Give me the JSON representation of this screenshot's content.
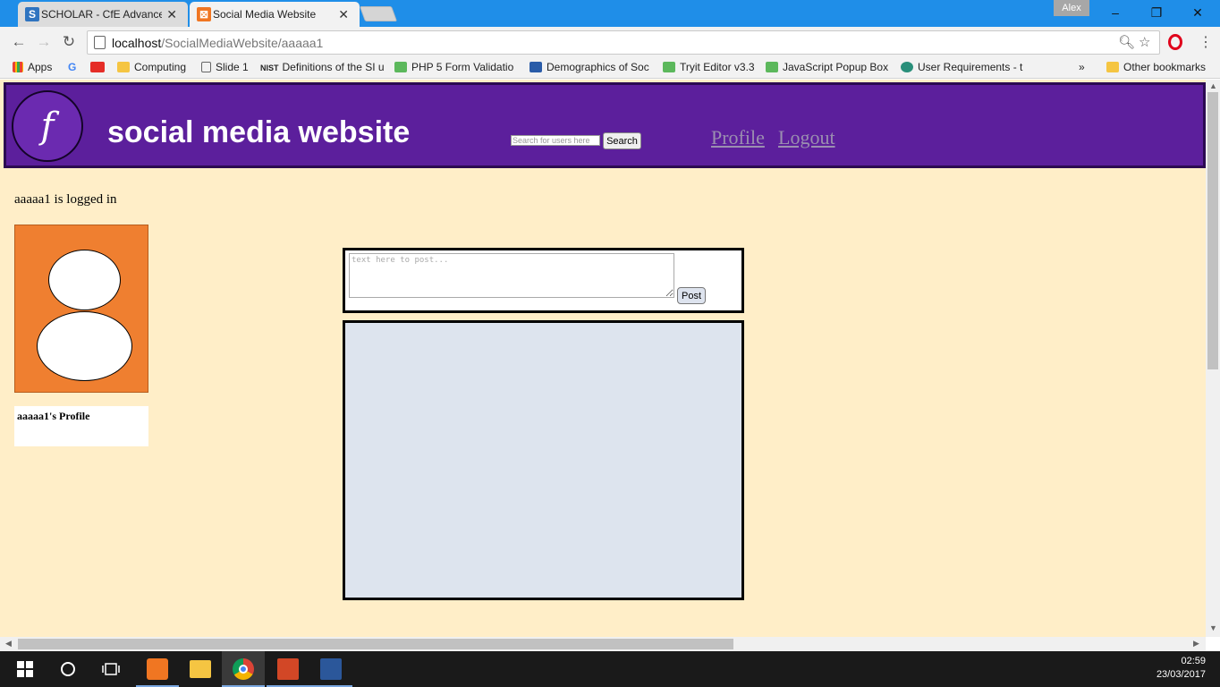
{
  "browser": {
    "tabs": [
      {
        "title": "SCHOLAR - CfE Advance",
        "icon": "scholar-icon",
        "active": false
      },
      {
        "title": "Social Media Website",
        "icon": "xampp-icon",
        "active": true
      }
    ],
    "user": "Alex",
    "window_controls": {
      "minimize": "–",
      "restore": "❐",
      "close": "✕"
    },
    "address": {
      "host": "localhost",
      "path": "/SocialMediaWebsite/aaaaa1"
    },
    "bookmarks": [
      {
        "label": "Apps",
        "icon": "apps-grid-icon"
      },
      {
        "label": "",
        "icon": "google-icon"
      },
      {
        "label": "",
        "icon": "youtube-icon"
      },
      {
        "label": "Computing",
        "icon": "folder-icon"
      },
      {
        "label": "Slide 1",
        "icon": "page-icon"
      },
      {
        "label": "Definitions of the SI u",
        "icon": "nist-icon"
      },
      {
        "label": "PHP 5 Form Validatio",
        "icon": "w3-icon"
      },
      {
        "label": "Demographics of Soc",
        "icon": "chart-icon"
      },
      {
        "label": "Tryit Editor v3.3",
        "icon": "w3-icon"
      },
      {
        "label": "JavaScript Popup Box",
        "icon": "w3-icon"
      },
      {
        "label": "User Requirements - t",
        "icon": "globe-icon"
      }
    ],
    "bookmarks_overflow": "»",
    "other_bookmarks": "Other bookmarks"
  },
  "site": {
    "logo_letter": "f",
    "title": "social media website",
    "search_placeholder": "Search for users here",
    "search_button": "Search",
    "nav": {
      "profile": "Profile",
      "logout": "Logout"
    },
    "login_status": "aaaaa1 is logged in",
    "profile_label": "aaaaa1's Profile",
    "post_placeholder": "text here to post...",
    "post_button": "Post"
  },
  "colors": {
    "header_bg": "#5c1f9c",
    "page_bg": "#ffeec8",
    "avatar_bg": "#ef7f30",
    "feed_bg": "#dde4ee"
  },
  "taskbar": {
    "time": "02:59",
    "date": "23/03/2017"
  }
}
